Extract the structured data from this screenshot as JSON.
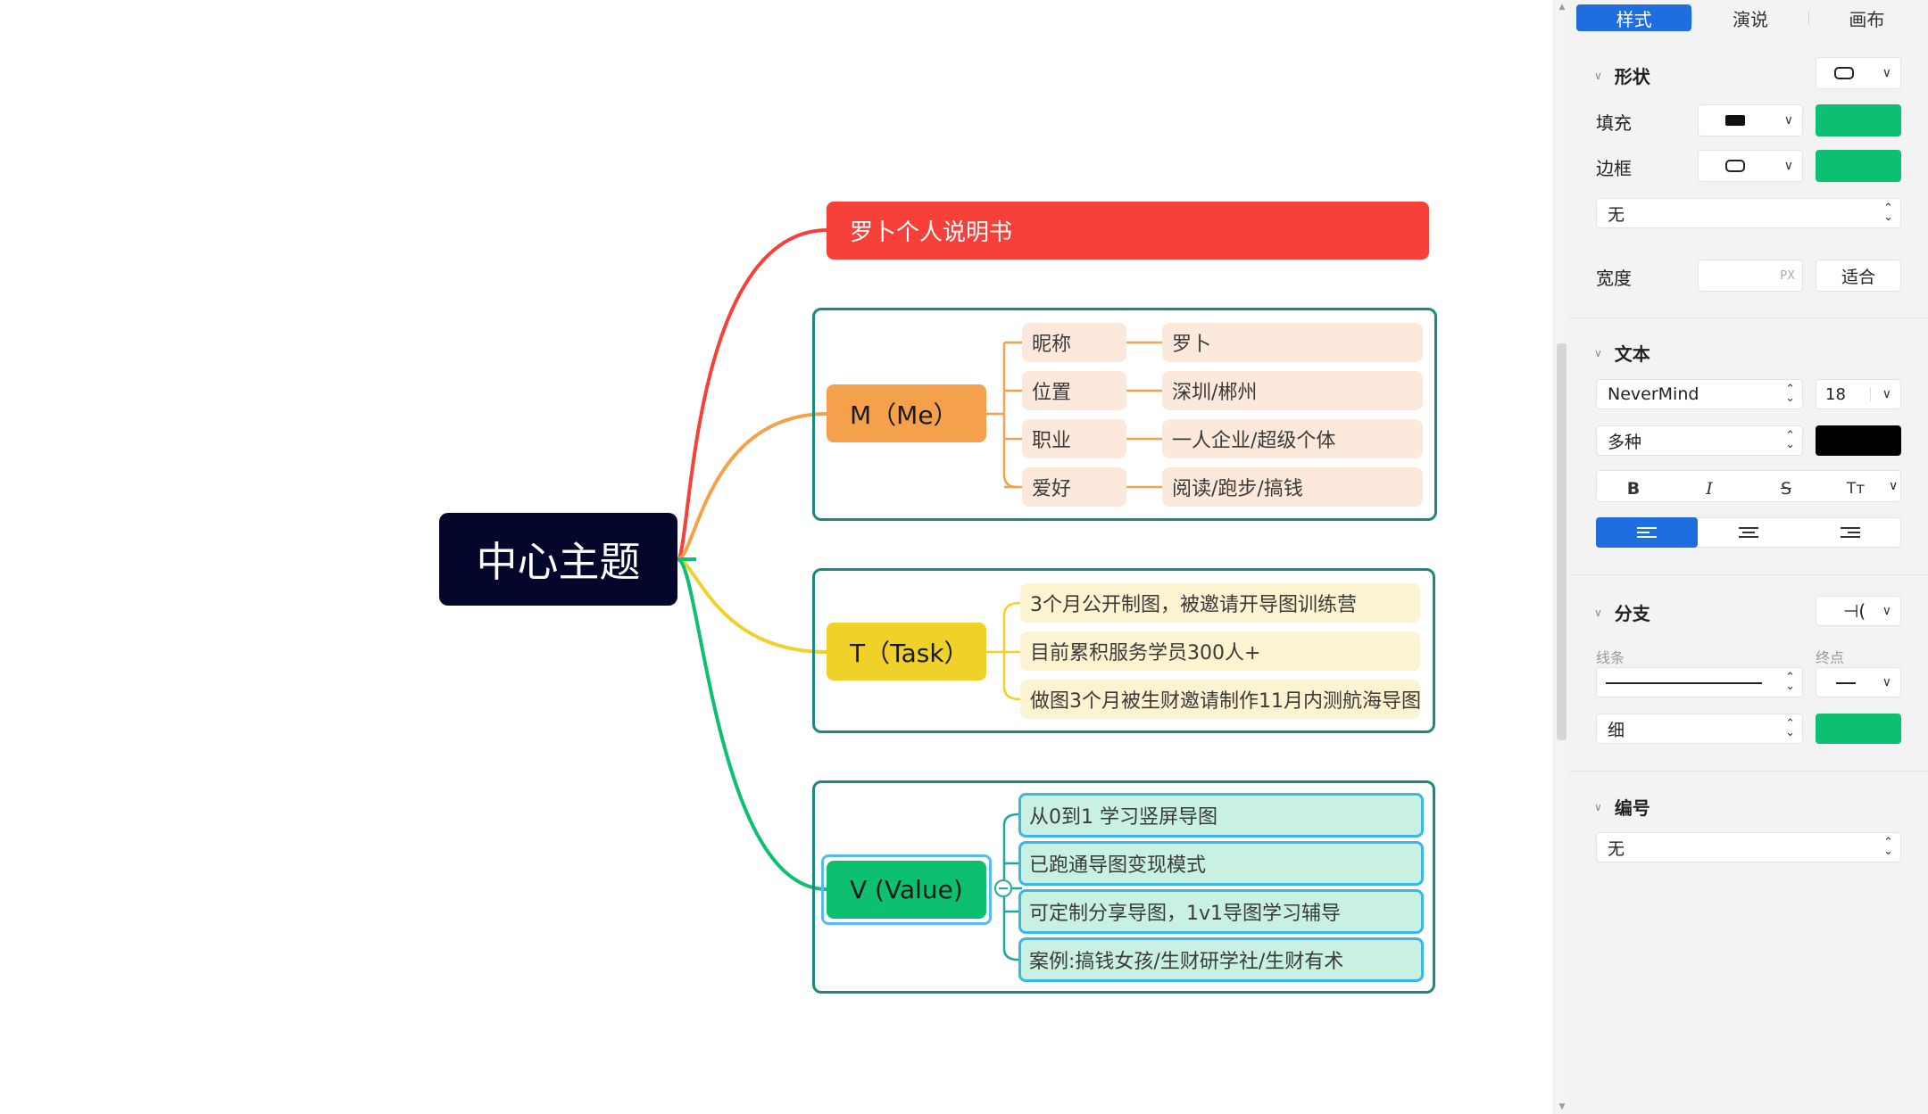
{
  "mindmap": {
    "center": "中心主题",
    "title_node": "罗卜个人说明书",
    "branches": [
      {
        "label": "M（Me）",
        "color": "#f5a04a",
        "items": [
          {
            "key": "昵称",
            "value": "罗卜"
          },
          {
            "key": "位置",
            "value": "深圳/郴州"
          },
          {
            "key": "职业",
            "value": "一人企业/超级个体"
          },
          {
            "key": "爱好",
            "value": "阅读/跑步/搞钱"
          }
        ]
      },
      {
        "label": "T（Task）",
        "color": "#f0d12a",
        "items": [
          "3个月公开制图，被邀请开导图训练营",
          "目前累积服务学员300人+",
          "做图3个月被生财邀请制作11月内测航海导图"
        ]
      },
      {
        "label": "V (Value)",
        "color": "#0dbf71",
        "items": [
          "从0到1 学习竖屏导图",
          "已跑通导图变现模式",
          "可定制分享导图，1v1导图学习辅导",
          "案例:搞钱女孩/生财研学社/生财有术"
        ]
      }
    ],
    "colors": {
      "center": "#04062b",
      "title": "#f8403a",
      "group_border": "#1a8a7d",
      "selection": "#55bbf0"
    }
  },
  "panel": {
    "tabs": [
      "样式",
      "演说",
      "画布"
    ],
    "active_tab": "样式",
    "shape": {
      "heading": "形状",
      "fill_label": "填充",
      "border_label": "边框",
      "border_style": "无",
      "width_label": "宽度",
      "width_value": "",
      "width_unit": "PX",
      "fit_button": "适合",
      "fill_color": "#0dbf71",
      "border_color": "#0dbf71"
    },
    "text": {
      "heading": "文本",
      "font": "NeverMind",
      "size": "18",
      "weight": "多种",
      "color": "#000000",
      "bold": "B",
      "italic": "I",
      "strike": "S",
      "case": "Tт"
    },
    "branch": {
      "heading": "分支",
      "line_label": "线条",
      "end_label": "终点",
      "thickness": "细",
      "color": "#0dbf71"
    },
    "numbering": {
      "heading": "编号",
      "value": "无"
    }
  }
}
